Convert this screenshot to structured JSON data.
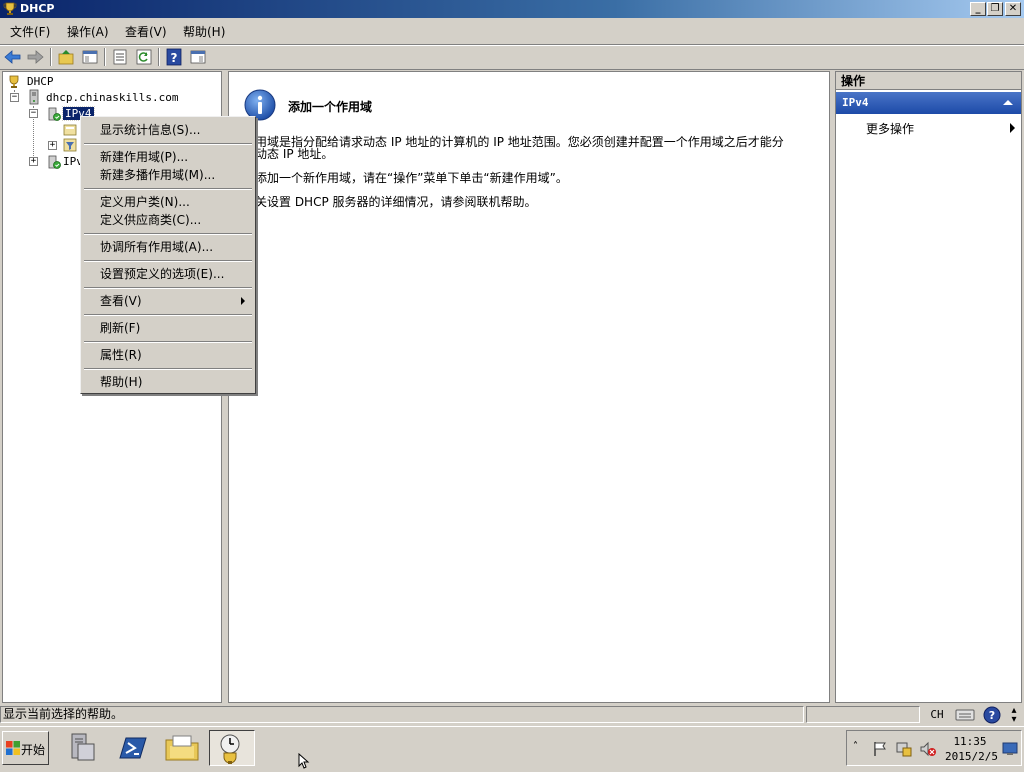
{
  "window": {
    "title": "DHCP"
  },
  "menu": [
    "文件(F)",
    "操作(A)",
    "查看(V)",
    "帮助(H)"
  ],
  "tree": {
    "root": "DHCP",
    "server": "dhcp.chinaskills.com",
    "ipv4": "IPv4",
    "ipv6": "IPv"
  },
  "context_menu": {
    "items": [
      "显示统计信息(S)...",
      "新建作用域(P)...",
      "新建多播作用域(M)...",
      "定义用户类(N)...",
      "定义供应商类(C)...",
      "协调所有作用域(A)...",
      "设置预定义的选项(E)...",
      "查看(V)",
      "刷新(F)",
      "属性(R)",
      "帮助(H)"
    ]
  },
  "main": {
    "heading": "添加一个作用域",
    "para1_line1": "用域是指分配给请求动态 IP 地址的计算机的 IP 地址范围。您必须创建并配置一个作用域之后才能分",
    "para1_line2": "动态 IP 地址。",
    "para2": "添加一个新作用域，请在“操作”菜单下单击“新建作用域”。",
    "para3": "关设置 DHCP 服务器的详细情况，请参阅联机帮助。"
  },
  "actions": {
    "header": "操作",
    "section": "IPv4",
    "more": "更多操作"
  },
  "status": {
    "text": "显示当前选择的帮助。"
  },
  "taskbar": {
    "start": "开始",
    "lang": "CH",
    "time": "11:35",
    "date": "2015/2/5"
  },
  "colors": {
    "titlebar": "#0a246a",
    "actions_section": "#1d4aa8",
    "selection": "#0a246a",
    "info_icon": "#1f5fbf"
  }
}
